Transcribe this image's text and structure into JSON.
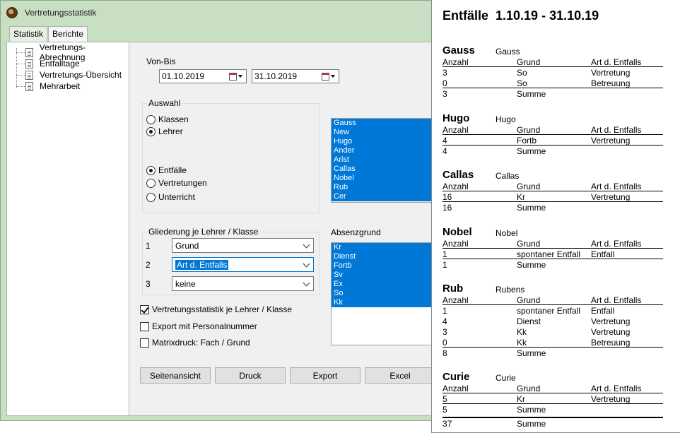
{
  "window": {
    "title": "Vertretungsstatistik"
  },
  "tabs": [
    {
      "label": "Statistik"
    },
    {
      "label": "Berichte"
    }
  ],
  "tree": [
    {
      "label": "Vertretungs-Abrechnung"
    },
    {
      "label": "Entfalltage"
    },
    {
      "label": "Vertretungs-Übersicht"
    },
    {
      "label": "Mehrarbeit"
    }
  ],
  "von_bis": {
    "label": "Von-Bis",
    "from": "01.10.2019",
    "to": "31.10.2019"
  },
  "auswahl": {
    "label": "Auswahl",
    "radio_scope": [
      {
        "label": "Klassen",
        "checked": false
      },
      {
        "label": "Lehrer",
        "checked": true
      }
    ],
    "radio_type": [
      {
        "label": "Entfälle",
        "checked": true
      },
      {
        "label": "Vertretungen",
        "checked": false
      },
      {
        "label": "Unterricht",
        "checked": false
      }
    ],
    "teachers": [
      "Gauss",
      "New",
      "Hugo",
      "Ander",
      "Arist",
      "Callas",
      "Nobel",
      "Rub",
      "Cer"
    ]
  },
  "gliederung": {
    "label": "Gliederung je Lehrer / Klasse",
    "rows": [
      {
        "num": "1",
        "value": "Grund"
      },
      {
        "num": "2",
        "value": "Art d. Entfalls"
      },
      {
        "num": "3",
        "value": "keine"
      }
    ]
  },
  "absenzgrund": {
    "label": "Absenzgrund",
    "items": [
      "Kr",
      "Dienst",
      "Fortb",
      "Sv",
      "Ex",
      "So",
      "Kk"
    ]
  },
  "checks": [
    {
      "label": "Vertretungsstatistik je Lehrer / Klasse",
      "checked": true
    },
    {
      "label": "Export mit Personalnummer",
      "checked": false
    },
    {
      "label": "Matrixdruck: Fach / Grund",
      "checked": false
    }
  ],
  "buttons": {
    "preview": "Seitenansicht",
    "print": "Druck",
    "export": "Export",
    "excel": "Excel"
  },
  "report": {
    "title": "Entfälle  1.10.19 - 31.10.19",
    "col_headers": [
      "Anzahl",
      "Grund",
      "Art d. Entfalls"
    ],
    "sum_label": "Summe",
    "blocks": [
      {
        "abbr": "Gauss",
        "full": "Gauss",
        "rows": [
          [
            "3",
            "So",
            "Vertretung"
          ],
          [
            "0",
            "So",
            "Betreuung"
          ]
        ],
        "sum": "3"
      },
      {
        "abbr": "Hugo",
        "full": "Hugo",
        "rows": [
          [
            "4",
            "Fortb",
            "Vertretung"
          ]
        ],
        "sum": "4"
      },
      {
        "abbr": "Callas",
        "full": "Callas",
        "rows": [
          [
            "16",
            "Kr",
            "Vertretung"
          ]
        ],
        "sum": "16"
      },
      {
        "abbr": "Nobel",
        "full": "Nobel",
        "rows": [
          [
            "1",
            "spontaner Entfall",
            "Entfall"
          ]
        ],
        "sum": "1"
      },
      {
        "abbr": "Rub",
        "full": "Rubens",
        "rows": [
          [
            "1",
            "spontaner Entfall",
            "Entfall"
          ],
          [
            "4",
            "Dienst",
            "Vertretung"
          ],
          [
            "3",
            "Kk",
            "Vertretung"
          ],
          [
            "0",
            "Kk",
            "Betreuung"
          ]
        ],
        "sum": "8"
      },
      {
        "abbr": "Curie",
        "full": "Curie",
        "rows": [
          [
            "5",
            "Kr",
            "Vertretung"
          ]
        ],
        "sum": "5"
      }
    ],
    "grand_total": "37"
  },
  "colors": {
    "selection": "#0078d7",
    "window_frame": "#c9dfc4"
  }
}
